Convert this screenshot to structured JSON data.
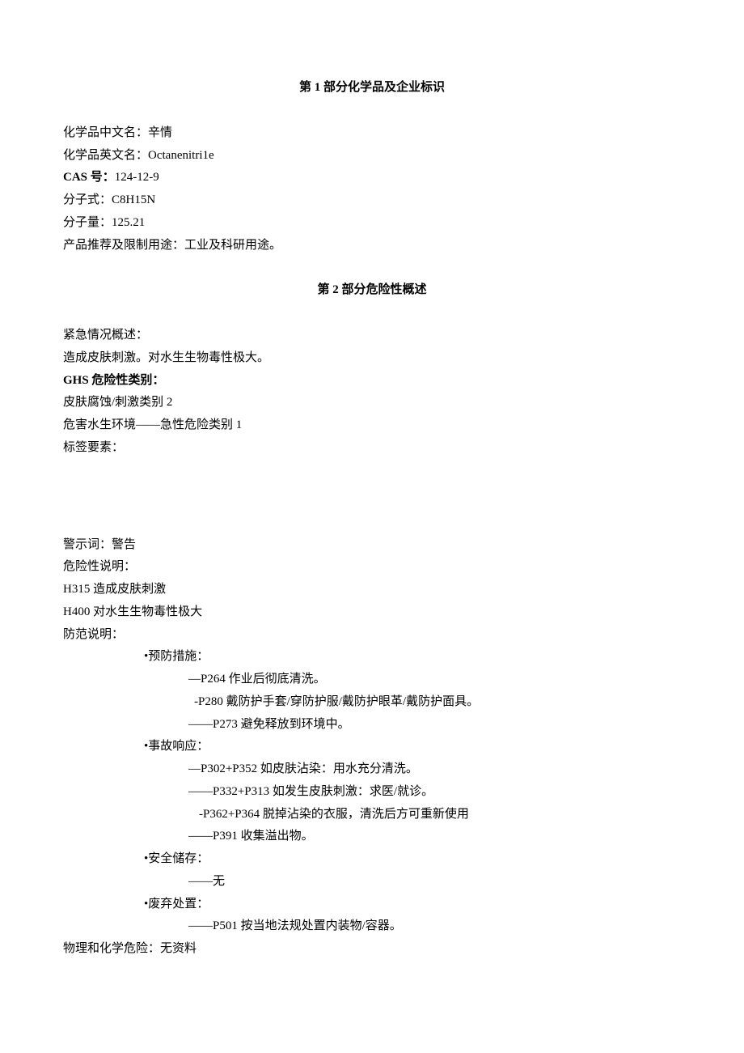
{
  "section1": {
    "title_pre": "第",
    "title_num": "1",
    "title_post": "部分化学品及企业标识",
    "name_cn_label": "化学品中文名：",
    "name_cn_value": "辛情",
    "name_en_label": "化学品英文名：",
    "name_en_value": "Octanenitri1e",
    "cas_label": "CAS 号：",
    "cas_value": "124-12-9",
    "formula_label": "分子式：",
    "formula_value": "C8H15N",
    "mw_label": "分子量：",
    "mw_value": "125.21",
    "use_label": "产品推荐及限制用途：",
    "use_value": "工业及科研用途。"
  },
  "section2": {
    "title_pre": "第",
    "title_num": "2",
    "title_post": "部分危险性概述",
    "emergency_label": "紧急情况概述：",
    "emergency_text": "造成皮肤刺激。对水生生物毒性极大。",
    "ghs_label": "GHS 危险性类别：",
    "ghs_line1": "皮肤腐蚀/刺激类别 2",
    "ghs_line2": "危害水生环境——急性危险类别 1",
    "label_elements": "标签要素：",
    "signal_label": "警示词：",
    "signal_value": "警告",
    "hazard_label": "危险性说明：",
    "h315": "H315 造成皮肤刺激",
    "h400": "H400 对水生生物毒性极大",
    "precaution_label": "防范说明：",
    "prevention_header": "•预防措施：",
    "p264": "—P264 作业后彻底清洗。",
    "p280": "-P280 戴防护手套/穿防护服/戴防护眼革/戴防护面具。",
    "p273": "——P273 避免释放到环境中。",
    "response_header": "•事故响应：",
    "p302": "—P302+P352 如皮肤沾染：用水充分清洗。",
    "p332": "——P332+P313 如发生皮肤刺激：求医/就诊。",
    "p362": "-P362+P364 脱掉沾染的衣服，清洗后方可重新使用",
    "p391": "——P391 收集溢出物。",
    "storage_header": "•安全储存：",
    "storage_none": "——无",
    "disposal_header": "•废弃处置：",
    "p501": "——P501 按当地法规处置内装物/容器。",
    "physchem_label": "物理和化学危险：",
    "physchem_value": "无资料"
  }
}
